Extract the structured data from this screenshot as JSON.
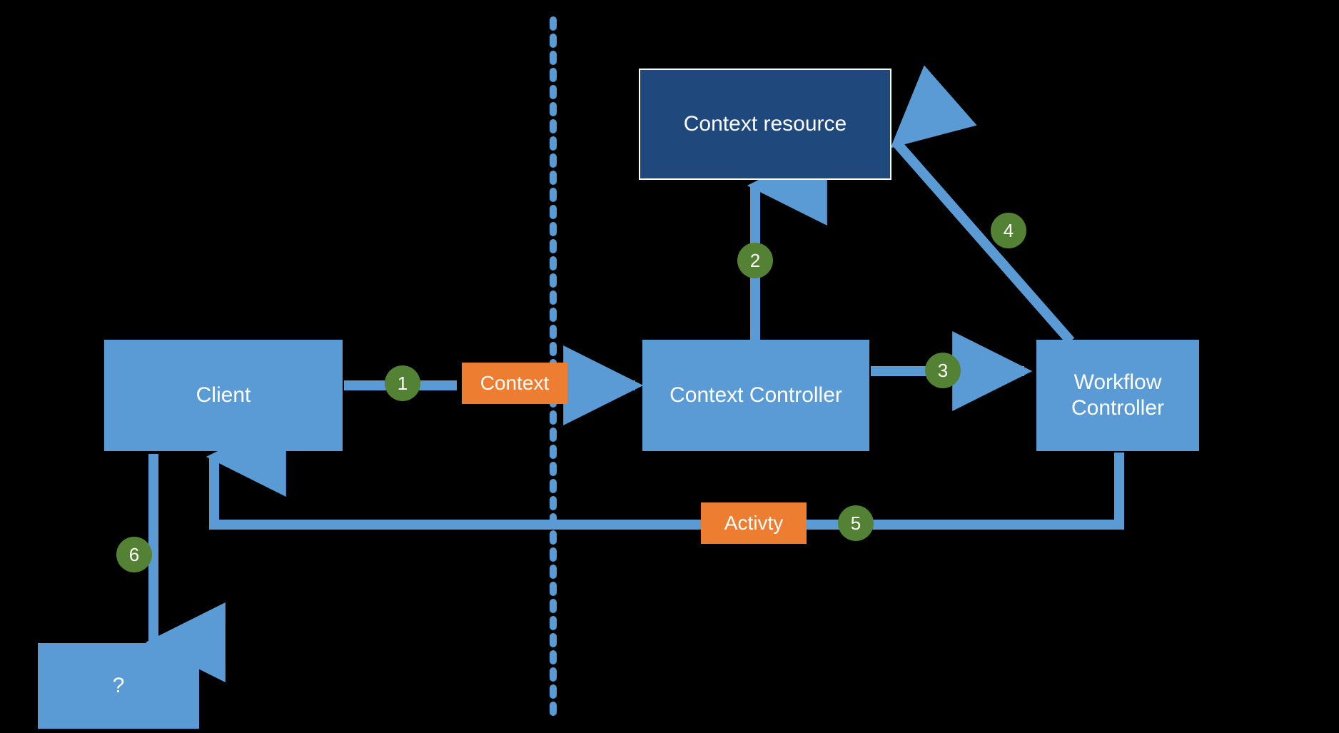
{
  "colors": {
    "bg": "#000000",
    "box_light": "#5b9bd5",
    "box_dark": "#1f497d",
    "box_orange": "#ed7d31",
    "step_green": "#548235",
    "arrow_blue": "#5b9bd5"
  },
  "boxes": {
    "context_resource": "Context resource",
    "client": "Client",
    "context_controller": "Context Controller",
    "workflow_controller": "Workflow\nController",
    "question_mark": "?",
    "context_label": "Context",
    "activity_label": "Activty"
  },
  "steps": {
    "s1": "1",
    "s2": "2",
    "s3": "3",
    "s4": "4",
    "s5": "5",
    "s6": "6"
  }
}
